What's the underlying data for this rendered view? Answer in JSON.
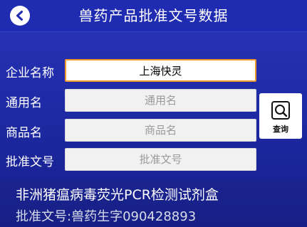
{
  "header": {
    "title": "兽药产品批准文号数据",
    "back_icon": "chevron-left-icon"
  },
  "form": {
    "company_label": "企业名称",
    "company_value": "上海快灵",
    "generic_label": "通用名",
    "generic_placeholder": "通用名",
    "product_label": "商品名",
    "product_placeholder": "商品名",
    "approval_label": "批准文号",
    "approval_placeholder": "批准文号"
  },
  "search_button": {
    "label": "查询",
    "icon": "search-icon"
  },
  "result": {
    "name": "非洲猪瘟病毒荧光PCR检测试剂盒",
    "approval_prefix": "批准文号:",
    "approval_number": "兽药生字090428893"
  },
  "colors": {
    "background": "#1f2aa6",
    "header": "#1f2bb0",
    "focus_border": "#f09a2c",
    "field_bg": "#f1f1f1"
  }
}
